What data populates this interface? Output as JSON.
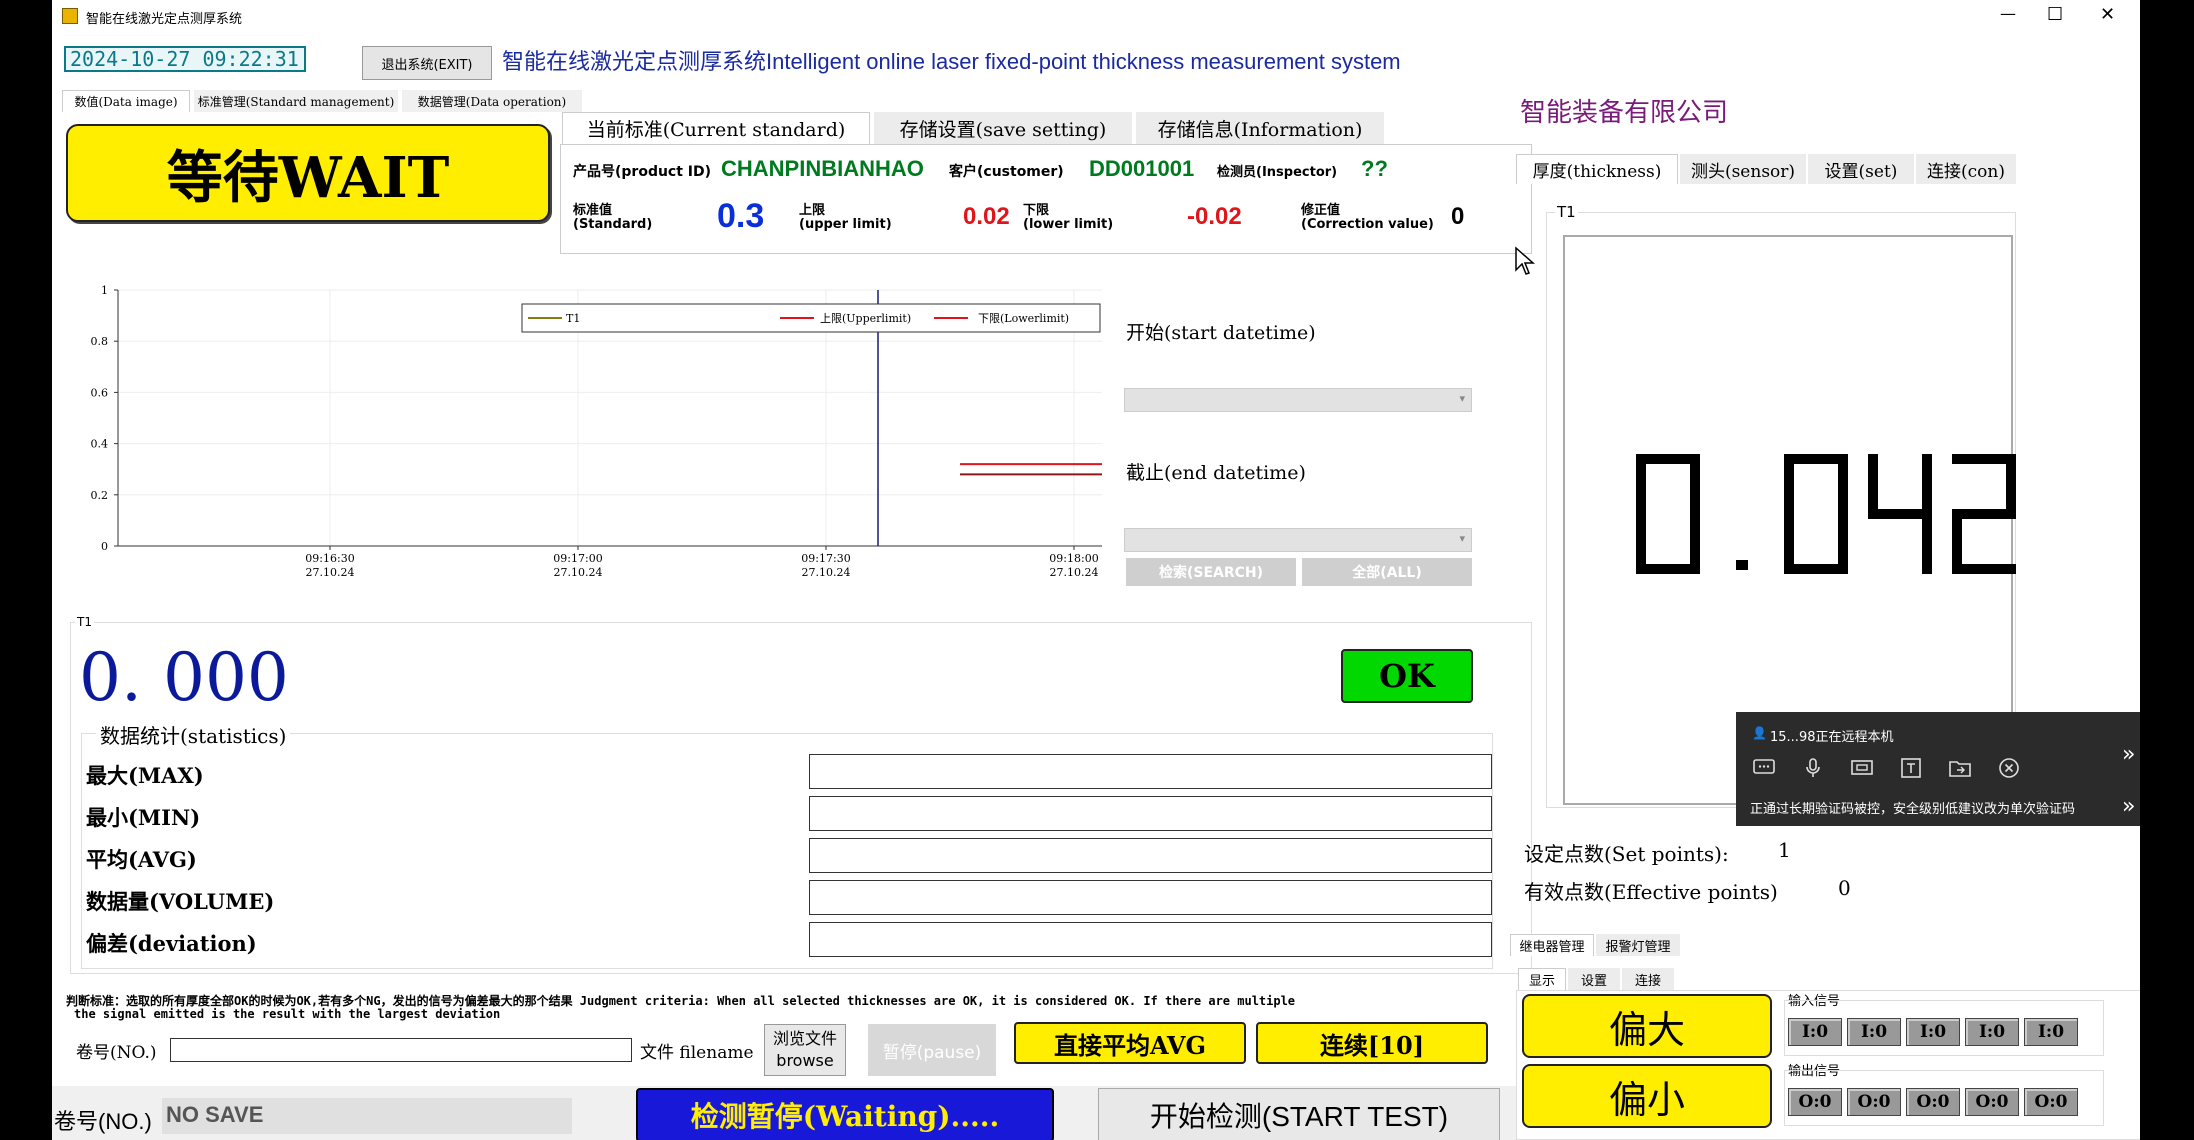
{
  "window": {
    "title": "智能在线激光定点测厚系统",
    "min": "—",
    "max": "☐",
    "close": "✕"
  },
  "header": {
    "datetime": "2024-10-27 09:22:31",
    "exit_button": "退出系统(EXIT)",
    "system_title": "智能在线激光定点测厚系统Intelligent online laser fixed-point thickness measurement system",
    "company": "智能装备有限公司"
  },
  "left_tabs": [
    "数值(Data image)",
    "标准管理(Standard management)",
    "数据管理(Data operation)"
  ],
  "status_button": "等待WAIT",
  "standard_tabs": [
    "当前标准(Current standard)",
    "存储设置(save setting)",
    "存储信息(Information)"
  ],
  "standard": {
    "product_label": "产品号(product ID)",
    "product_value": "CHANPINBIANHAO",
    "customer_label": "客户(customer)",
    "customer_value": "DD001001",
    "inspector_label": "检测员(Inspector)",
    "inspector_value": "??",
    "std_label_cn": "标准值",
    "std_label_en": "(Standard)",
    "std_value": "0.3",
    "upper_label_cn": "上限",
    "upper_label_en": "(upper limit)",
    "upper_value": "0.02",
    "lower_label_cn": "下限",
    "lower_label_en": "(lower limit)",
    "lower_value": "-0.02",
    "corr_label_cn": "修正值",
    "corr_label_en": "(Correction value)",
    "corr_value": "0",
    "colors": {
      "product": "#007a1e",
      "standard": "#0a2fd8",
      "limits": "#e0141a"
    }
  },
  "chart_data": {
    "type": "line",
    "x_ticks": [
      {
        "time": "09:16:30",
        "date": "27.10.24"
      },
      {
        "time": "09:17:00",
        "date": "27.10.24"
      },
      {
        "time": "09:17:30",
        "date": "27.10.24"
      },
      {
        "time": "09:18:00",
        "date": "27.10.24"
      }
    ],
    "y_ticks": [
      "1",
      "0.8",
      "0.6",
      "0.4",
      "0.2",
      "0"
    ],
    "ylim": [
      0,
      1
    ],
    "grid": true,
    "legend_position": "top",
    "series": [
      {
        "name": "T1",
        "color": "#8a7a10"
      },
      {
        "name": "上限(Upperlimit)",
        "color": "#e0141a"
      },
      {
        "name": "下限(Lowerlimit)",
        "color": "#e0141a"
      }
    ],
    "limit_segments": [
      {
        "y": 0.32
      },
      {
        "y": 0.28
      }
    ],
    "cursor_time": "09:17:47"
  },
  "search": {
    "start_label": "开始(start datetime)",
    "end_label": "截止(end datetime)",
    "search_button": "检索(SEARCH)",
    "all_button": "全部(ALL)"
  },
  "t1_panel": {
    "group_label": "T1",
    "reading": "0. 000",
    "ok_button": "OK",
    "stats_title": "数据统计(statistics)",
    "stats": [
      "最大(MAX)",
      "最小(MIN)",
      "平均(AVG)",
      "数据量(VOLUME)",
      "偏差(deviation)"
    ]
  },
  "judgment": {
    "line1": "判断标准：选取的所有厚度全部OK的时候为OK,若有多个NG，发出的信号为偏差最大的那个结果 Judgment criteria: When all selected thicknesses are OK, it is considered OK. If there are multiple",
    "line2": "the signal emitted is the result with the largest deviation"
  },
  "bottom": {
    "roll_label": "卷号(NO.)",
    "file_label": "文件 filename",
    "browse_button_1": "浏览文件",
    "browse_button_2": "browse",
    "pause_button": "暂停(pause)",
    "avg_button": "直接平均AVG",
    "continuous_button": "连续[10]",
    "roll_label_2": "卷号(NO.)",
    "no_save": "NO SAVE",
    "waiting_button": "检测暂停(Waiting).....",
    "start_button": "开始检测(START TEST)"
  },
  "right_tabs": [
    "厚度(thickness)",
    "测头(sensor)",
    "设置(set)",
    "连接(con)"
  ],
  "display": {
    "label": "T1",
    "value": "0.042"
  },
  "points": {
    "set_label": "设定点数(Set points):",
    "set_value": "1",
    "effective_label": "有效点数(Effective points)",
    "effective_value": "0"
  },
  "relay_tabs": [
    "继电器管理",
    "报警灯管理"
  ],
  "relay_subtabs": [
    "显示",
    "设置",
    "连接"
  ],
  "relay": {
    "big_button": "偏大",
    "small_button": "偏小",
    "input_label": "输入信号",
    "output_label": "输出信号",
    "inputs": [
      "I:0",
      "I:0",
      "I:0",
      "I:0",
      "I:0"
    ],
    "outputs": [
      "O:0",
      "O:0",
      "O:0",
      "O:0",
      "O:0"
    ]
  },
  "remote": {
    "status": "15...98正在远程本机",
    "warning": "正通过长期验证码被控，安全级别低建议改为单次验证码",
    "icons": [
      "chat-icon",
      "microphone-icon",
      "screen-share-icon",
      "text-icon",
      "file-transfer-icon",
      "close-circle-icon"
    ]
  }
}
